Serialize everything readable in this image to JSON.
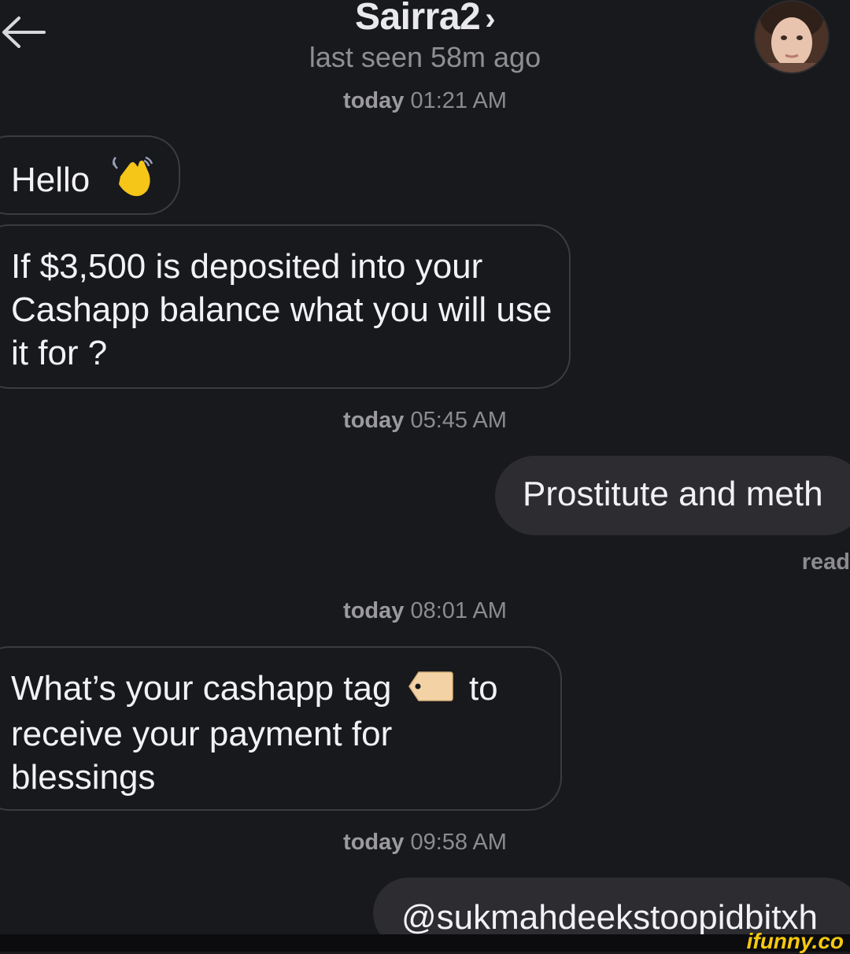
{
  "header": {
    "contact_name": "Sairra2",
    "chevron": "›",
    "last_seen": "last seen 58m ago",
    "back_icon": "arrow-left-icon",
    "avatar_icon": "avatar"
  },
  "messages": [
    {
      "type": "stamp",
      "day": "today",
      "time": "01:21 AM"
    },
    {
      "type": "incoming",
      "text": "Hello",
      "emoji": "waving-hand"
    },
    {
      "type": "incoming",
      "text": "If $3,500 is deposited into your Cashapp balance what you will use it for ?"
    },
    {
      "type": "stamp",
      "day": "today",
      "time": "05:45 AM"
    },
    {
      "type": "outgoing",
      "text": "Prostitute and meth"
    },
    {
      "type": "status",
      "text": "read"
    },
    {
      "type": "stamp",
      "day": "today",
      "time": "08:01 AM"
    },
    {
      "type": "incoming",
      "text_before": "What’s your cashapp tag",
      "emoji": "label-tag",
      "text_after": "to receive your payment for blessings"
    },
    {
      "type": "stamp",
      "day": "today",
      "time": "09:58 AM"
    },
    {
      "type": "outgoing",
      "text": "@sukmahdeekstoopidbitxh"
    }
  ],
  "watermark": "ifunny.co",
  "colors": {
    "background": "#18191d",
    "incoming_border": "#3b3b40",
    "outgoing_bubble": "#2c2c31",
    "secondary_text": "#8b8b90",
    "watermark": "#f6c90e"
  }
}
